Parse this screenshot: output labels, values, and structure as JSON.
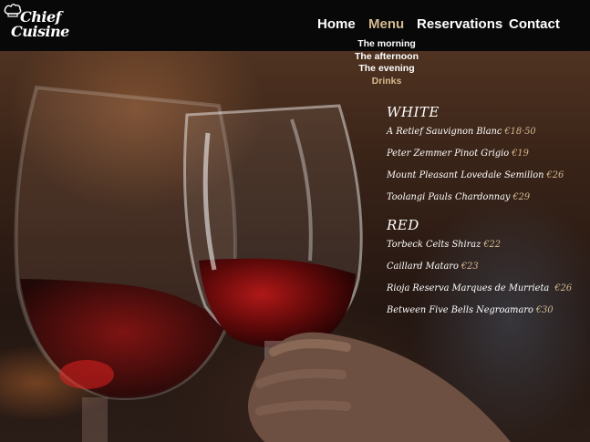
{
  "brand": {
    "line1": "Chief",
    "line2": "Cuisine"
  },
  "nav": {
    "items": [
      {
        "label": "Home",
        "active": false
      },
      {
        "label": "Menu",
        "active": true
      },
      {
        "label": "Reservations",
        "active": false
      },
      {
        "label": "Contact",
        "active": false
      }
    ],
    "dropdown": [
      {
        "label": "The morning",
        "active": false
      },
      {
        "label": "The afternoon",
        "active": false
      },
      {
        "label": "The evening",
        "active": false
      },
      {
        "label": "Drinks",
        "active": true
      }
    ]
  },
  "menu": {
    "white": {
      "title": "WHITE",
      "items": [
        {
          "name": "A Retief Sauvignon Blanc",
          "price": "€18·50"
        },
        {
          "name": "Peter Zemmer Pinot Grigio",
          "price": "€19"
        },
        {
          "name": "Mount Pleasant Lovedale Semillon",
          "price": "€26"
        },
        {
          "name": "Toolangi Pauls Chardonnay",
          "price": "€29"
        }
      ]
    },
    "red": {
      "title": "RED",
      "items": [
        {
          "name": "Torbeck Celts Shiraz",
          "price": "€22"
        },
        {
          "name": "Caillard Mataro",
          "price": "€23"
        },
        {
          "name": "Rioja Reserva Marques de Murrieta ",
          "price": "€26"
        },
        {
          "name": "Between Five Bells Negroamaro",
          "price": "€30"
        }
      ]
    }
  },
  "colors": {
    "accent": "#d5b98f",
    "navbar": "#080808",
    "text": "#ffffff"
  }
}
